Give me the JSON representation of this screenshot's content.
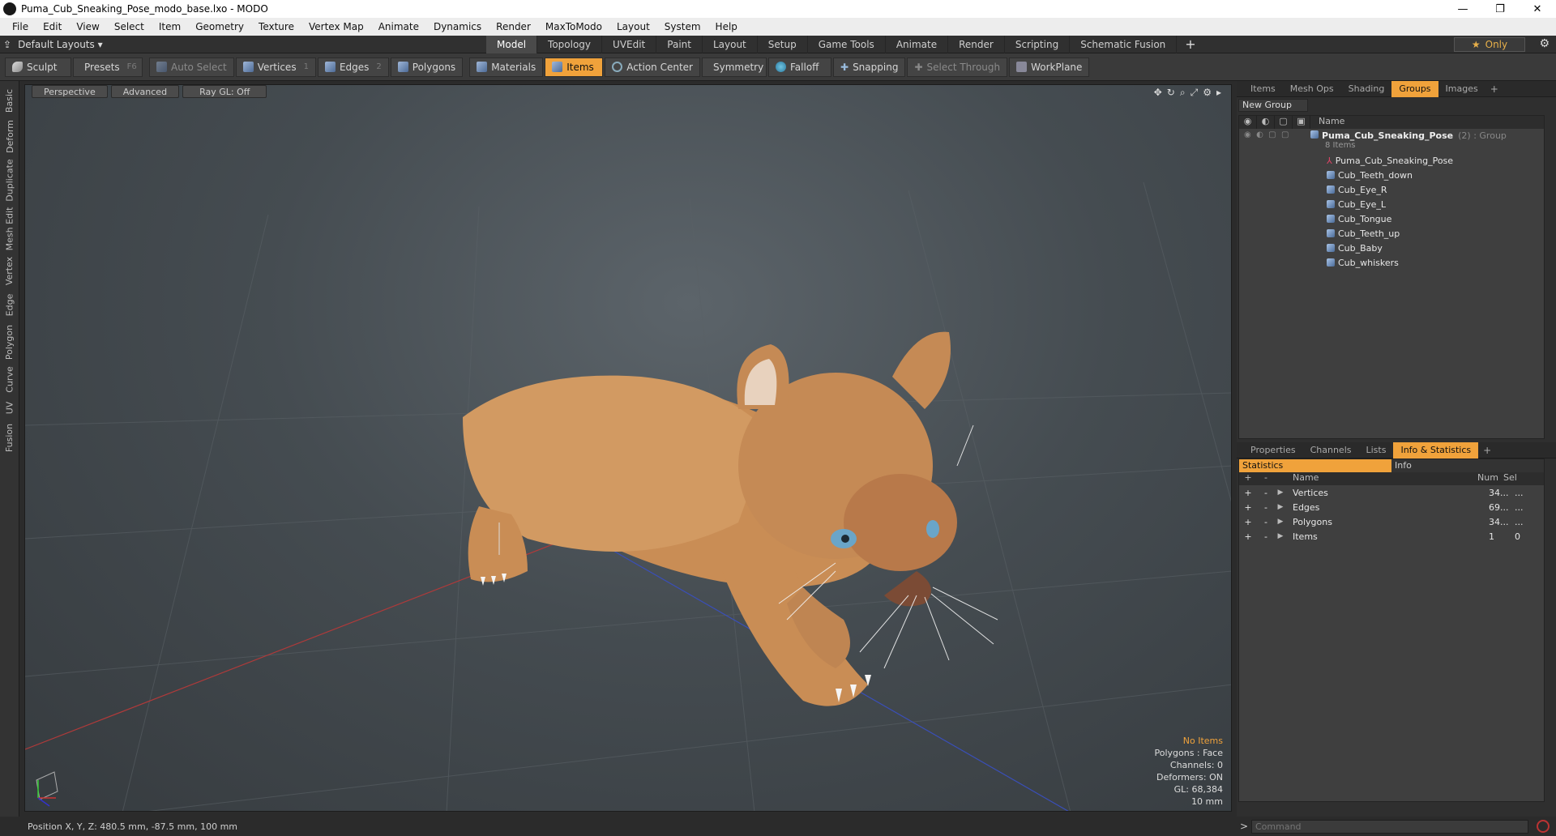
{
  "window": {
    "title": "Puma_Cub_Sneaking_Pose_modo_base.lxo - MODO",
    "minimize": "—",
    "maximize": "❐",
    "close": "✕"
  },
  "menu": [
    "File",
    "Edit",
    "View",
    "Select",
    "Item",
    "Geometry",
    "Texture",
    "Vertex Map",
    "Animate",
    "Dynamics",
    "Render",
    "MaxToModo",
    "Layout",
    "System",
    "Help"
  ],
  "layoutbar": {
    "layout_name": "Default Layouts ▾",
    "tabs": [
      "Model",
      "Topology",
      "UVEdit",
      "Paint",
      "Layout",
      "Setup",
      "Game Tools",
      "Animate",
      "Render",
      "Scripting",
      "Schematic Fusion"
    ],
    "active_tab": "Model",
    "plus": "+",
    "only_label": "Only",
    "star": "★",
    "gear": "⚙"
  },
  "toolbar": {
    "sculpt": "Sculpt",
    "presets": "Presets",
    "presets_key": "F6",
    "auto_select": "Auto Select",
    "vertices": "Vertices",
    "vertices_key": "1",
    "edges": "Edges",
    "edges_key": "2",
    "polygons": "Polygons",
    "materials": "Materials",
    "items": "Items",
    "action_center": "Action Center",
    "symmetry": "Symmetry",
    "falloff": "Falloff",
    "snapping": "Snapping",
    "select_through": "Select Through",
    "workplane": "WorkPlane"
  },
  "left_tabs": [
    "Basic",
    "Deform",
    "Duplicate",
    "Mesh Edit",
    "Vertex",
    "Edge",
    "Polygon",
    "Curve",
    "UV",
    "Fusion"
  ],
  "viewport": {
    "buttons": [
      "Perspective",
      "Advanced",
      "Ray GL: Off"
    ],
    "icons": [
      "✥",
      "↻",
      "⌕",
      "⤢",
      "⚙",
      "▸"
    ],
    "stats": {
      "selection": "No Items",
      "polygons": "Polygons : Face",
      "channels": "Channels: 0",
      "deformers": "Deformers: ON",
      "gl": "GL: 68,384",
      "scale": "10 mm"
    }
  },
  "groups_panel": {
    "tabs": [
      "Items",
      "Mesh Ops",
      "Shading",
      "Groups",
      "Images"
    ],
    "active_tab": "Groups",
    "plus": "+",
    "new_group": "New Group",
    "column_name": "Name",
    "group": {
      "name": "Puma_Cub_Sneaking_Pose",
      "note": "(2) : Group",
      "count": "8 Items"
    },
    "items": [
      {
        "name": "Puma_Cub_Sneaking_Pose",
        "type": "locator"
      },
      {
        "name": "Cub_Teeth_down",
        "type": "mesh"
      },
      {
        "name": "Cub_Eye_R",
        "type": "mesh"
      },
      {
        "name": "Cub_Eye_L",
        "type": "mesh"
      },
      {
        "name": "Cub_Tongue",
        "type": "mesh"
      },
      {
        "name": "Cub_Teeth_up",
        "type": "mesh"
      },
      {
        "name": "Cub_Baby",
        "type": "mesh"
      },
      {
        "name": "Cub_whiskers",
        "type": "mesh"
      }
    ]
  },
  "stats_panel": {
    "tabs": [
      "Properties",
      "Channels",
      "Lists",
      "Info & Statistics"
    ],
    "active_tab": "Info & Statistics",
    "plus": "+",
    "subtabs": [
      "Statistics",
      "Info"
    ],
    "columns": {
      "add": "+",
      "remove": "-",
      "name": "Name",
      "num": "Num",
      "sel": "Sel"
    },
    "rows": [
      {
        "name": "Vertices",
        "num": "34...",
        "sel": "..."
      },
      {
        "name": "Edges",
        "num": "69...",
        "sel": "..."
      },
      {
        "name": "Polygons",
        "num": "34...",
        "sel": "..."
      },
      {
        "name": "Items",
        "num": "1",
        "sel": "0"
      }
    ]
  },
  "statusbar": {
    "position": "Position X, Y, Z:  480.5 mm, -87.5 mm, 100 mm"
  },
  "command": {
    "prompt": ">",
    "placeholder": "Command"
  },
  "colors": {
    "accent": "#f0a23b",
    "viewport_bg": "#454c51",
    "panel_bg": "#3f3f3f"
  }
}
